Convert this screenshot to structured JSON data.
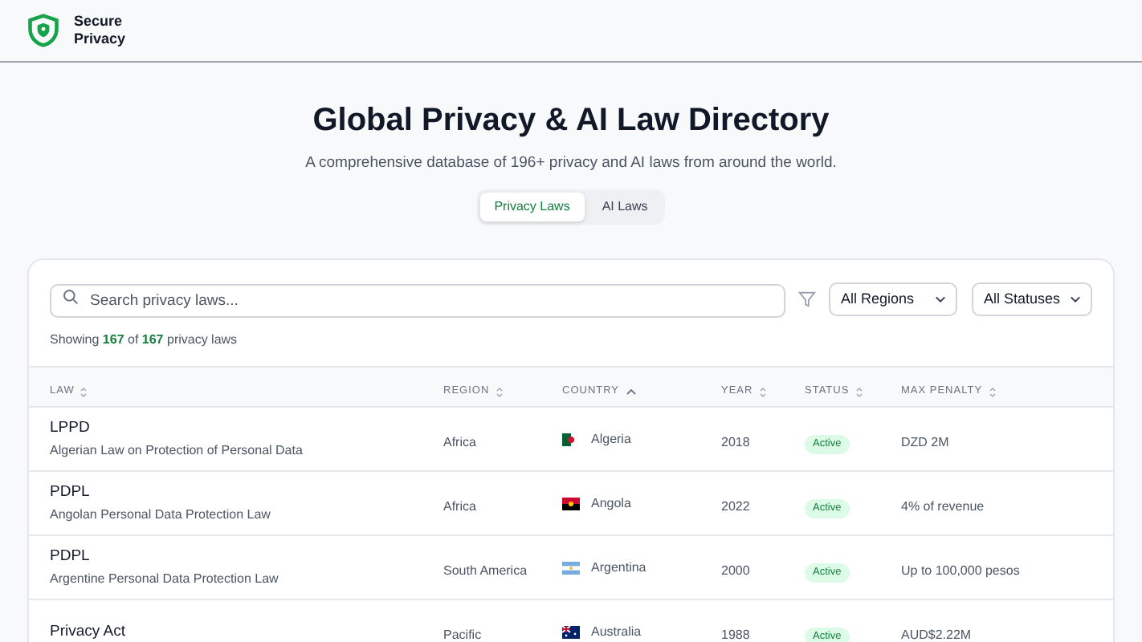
{
  "brand": {
    "line_1": "Secure",
    "line_2": "Privacy"
  },
  "hero": {
    "title": "Global Privacy & AI Law Directory",
    "subtitle": "A comprehensive database of 196+ privacy and AI laws from around the world."
  },
  "tabs": [
    {
      "label": "Privacy Laws",
      "selected": true
    },
    {
      "label": "AI Laws",
      "selected": false
    }
  ],
  "search": {
    "placeholder": "Search privacy laws..."
  },
  "filters": [
    {
      "value": "All Regions"
    },
    {
      "value": "All Statuses"
    }
  ],
  "summary": "Showing **167** of **167** privacy laws",
  "table": {
    "columns": [
      {
        "label": "LAW",
        "sorted": false
      },
      {
        "label": "REGION",
        "sorted": false
      },
      {
        "label": "COUNTRY",
        "sorted": true
      },
      {
        "label": "YEAR",
        "sorted": false
      },
      {
        "label": "STATUS",
        "sorted": false
      },
      {
        "label": "MAX PENALTY",
        "sorted": false
      }
    ],
    "rows": [
      {
        "law": "LPPD",
        "full_name": "Algerian Law on Protection of Personal Data",
        "region": "Africa",
        "country": "Algeria",
        "year": "2018",
        "status": "Active",
        "penalty": "DZD 2M"
      },
      {
        "law": "PDPL",
        "full_name": "Angolan Personal Data Protection Law",
        "region": "Africa",
        "country": "Angola",
        "year": "2022",
        "status": "Active",
        "penalty": "4% of revenue"
      },
      {
        "law": "PDPL",
        "full_name": "Argentine Personal Data Protection Law",
        "region": "South America",
        "country": "Argentina",
        "year": "2000",
        "status": "Active",
        "penalty": "Up to 100,000 pesos"
      },
      {
        "law": "Privacy Act",
        "region": "Pacific",
        "country": "Australia",
        "year": "1988",
        "status": "Active",
        "penalty": "AUD$2.22M"
      }
    ]
  }
}
